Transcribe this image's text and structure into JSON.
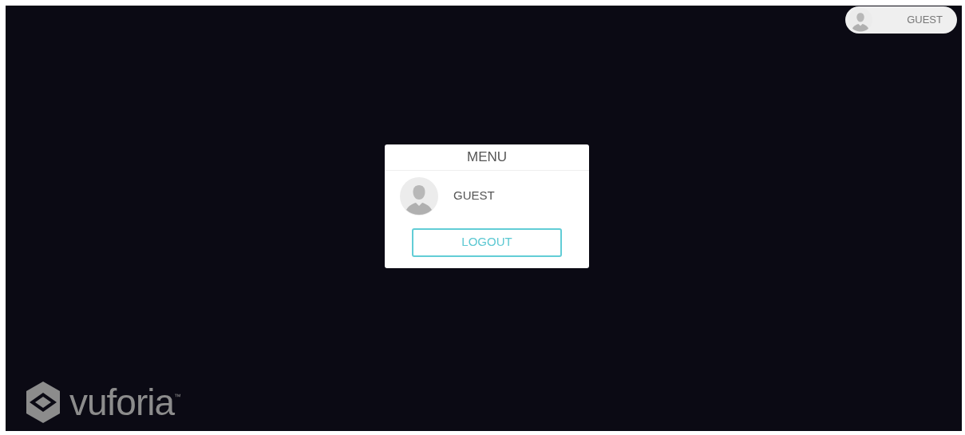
{
  "user_badge": {
    "name": "GUEST"
  },
  "menu": {
    "title": "MENU",
    "user": {
      "name": "GUEST"
    },
    "buttons": [
      {
        "label": "LOGOUT",
        "kind": "outline"
      }
    ]
  },
  "logo": {
    "wordmark": "vuforia",
    "mark": "™"
  }
}
